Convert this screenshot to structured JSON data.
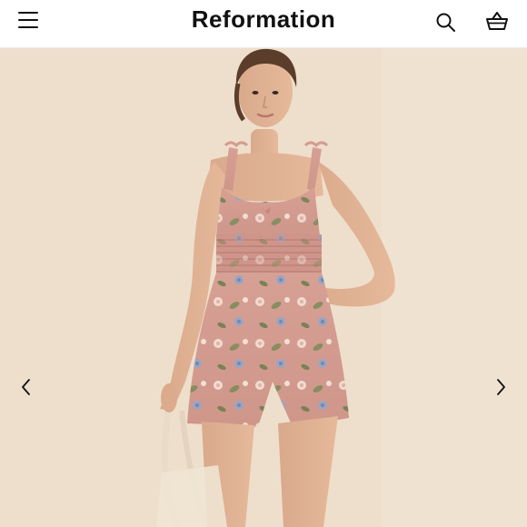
{
  "header": {
    "brand": "Reformation",
    "menu_icon": "hamburger-menu-icon",
    "search_icon": "search-icon",
    "cart_icon": "shopping-basket-icon"
  },
  "gallery": {
    "image": "model-wearing-pink-floral-ruffle-strap-romper",
    "prev_icon": "chevron-left-icon",
    "next_icon": "chevron-right-icon"
  },
  "colors": {
    "background": "#efe0cd",
    "garment": "#d9a096",
    "text": "#111111"
  }
}
